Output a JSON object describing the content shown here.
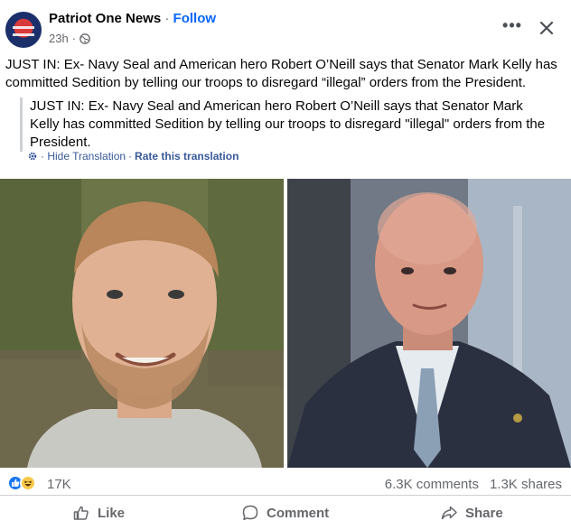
{
  "header": {
    "page_name": "Patriot One News",
    "separator": "·",
    "follow_label": "Follow",
    "time_ago": "23h",
    "meta_sep": "·",
    "privacy_icon": "globe-icon",
    "more_icon": "more-options-icon",
    "close_icon": "close-icon"
  },
  "post": {
    "text": "JUST IN: Ex- Navy Seal and American hero Robert O’Neill says that Senator Mark Kelly has committed Sedition by telling our troops to disregard “illegal” orders from the President."
  },
  "translation": {
    "text": "JUST IN: Ex- Navy Seal and American hero Robert O’Neill says that Senator Mark Kelly has committed Sedition by telling our troops to disregard \"illegal\" orders from the President.",
    "gear_icon": "gear-icon",
    "hide_label": "· Hide Translation",
    "sep": "·",
    "rate_label": "Rate this translation"
  },
  "photos": [
    {
      "description_icon": "photo-man-beard"
    },
    {
      "description_icon": "photo-man-suit"
    }
  ],
  "reactions": {
    "icons": [
      "like-reaction-icon",
      "haha-reaction-icon"
    ],
    "count": "17K",
    "comments": "6.3K comments",
    "shares": "1.3K shares"
  },
  "actions": {
    "like": "Like",
    "comment": "Comment",
    "share": "Share"
  },
  "colors": {
    "accent": "#0866ff",
    "secondary_text": "#65676b",
    "like_blue": "#1877f2"
  }
}
